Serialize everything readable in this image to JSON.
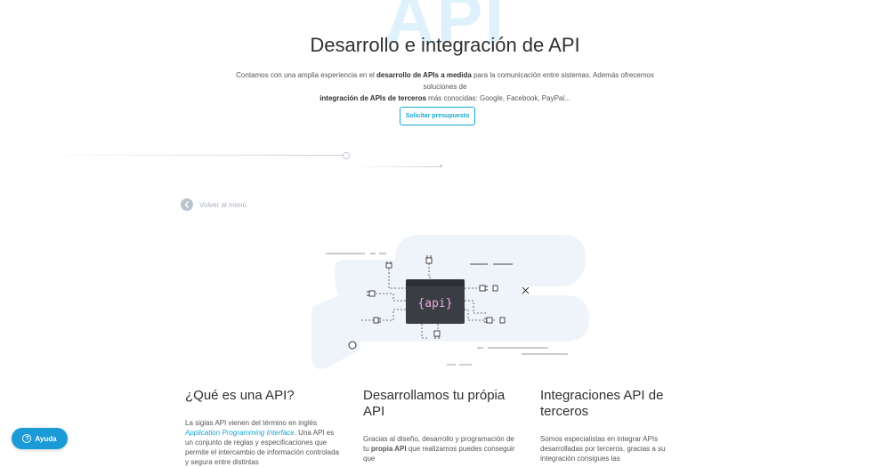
{
  "hero": {
    "bg_word": "API",
    "title": "Desarrollo e integración de API",
    "desc_1": "Contamos con una amplia experiencia en el ",
    "desc_2": "desarrollo de APIs a medida",
    "desc_3": " para la comunicación entre sistemas. Además ofrecemos soluciones de ",
    "desc_4": "integración de APIs de terceros",
    "desc_5": " más conocidas: Google, Facebook, PayPal...",
    "cta_label": "Solicitar presupuesto"
  },
  "nav": {
    "back_label": "Volver al menú"
  },
  "illustration": {
    "screen_text": "{api}"
  },
  "sections": [
    {
      "title": "¿Qué es una API?",
      "text_1": "La siglas API vienen del término en inglés ",
      "link": "Application Programming Interface",
      "text_2": ". Una API es un conjunto de reglas y especificaciones que permite el intercambio de información controlada y segura entre distintas"
    },
    {
      "title": "Desarrollamos tu própia API",
      "text_1": "Gracias al diseño, desarrollo y programación de tu ",
      "bold": "propia API",
      "text_2": " que realizamos puedes conseguir que"
    },
    {
      "title": "Integraciones API de terceros",
      "text_1": "Somos especialistas en integrar APIs desarrolladas por terceros, gracias a su integración consigues las"
    }
  ],
  "help_widget": {
    "label": "Ayuda"
  },
  "colors": {
    "accent": "#19a6d1",
    "help_bg": "#1a9ad6",
    "screen_text": "#f0a8e0",
    "blob": "#eef4fa"
  }
}
